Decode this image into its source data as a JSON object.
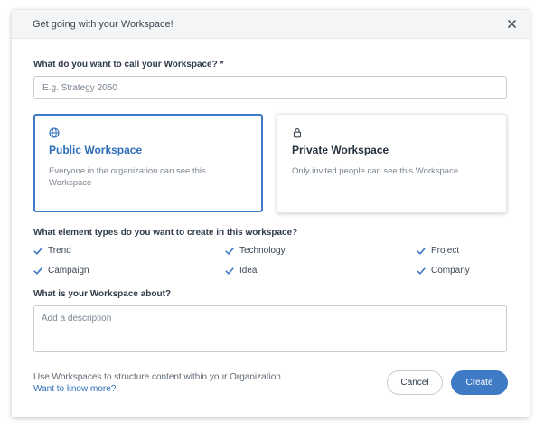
{
  "dialog": {
    "title": "Get going with your Workspace!"
  },
  "name_field": {
    "label": "What do you want to call your Workspace? *",
    "placeholder": "E.g. Strategy 2050",
    "value": ""
  },
  "visibility_options": [
    {
      "icon": "globe-icon",
      "title": "Public Workspace",
      "description": "Everyone in the organization can see this Workspace",
      "selected": true
    },
    {
      "icon": "lock-icon",
      "title": "Private Workspace",
      "description": "Only invited people can see this Workspace",
      "selected": false
    }
  ],
  "element_types": {
    "label": "What element types do you want to create in this workspace?",
    "items": [
      {
        "label": "Trend",
        "checked": true
      },
      {
        "label": "Technology",
        "checked": true
      },
      {
        "label": "Project",
        "checked": true
      },
      {
        "label": "Campaign",
        "checked": true
      },
      {
        "label": "Idea",
        "checked": true
      },
      {
        "label": "Company",
        "checked": true
      }
    ]
  },
  "about_field": {
    "label": "What is your Workspace about?",
    "placeholder": "Add a description",
    "value": ""
  },
  "footer": {
    "info_text": "Use Workspaces to structure content within your Organization.",
    "link_text": "Want to know more?",
    "cancel_label": "Cancel",
    "create_label": "Create"
  },
  "colors": {
    "accent": "#3f7ac4",
    "check": "#3f7ac4",
    "header_bg": "#f4f5f7"
  }
}
